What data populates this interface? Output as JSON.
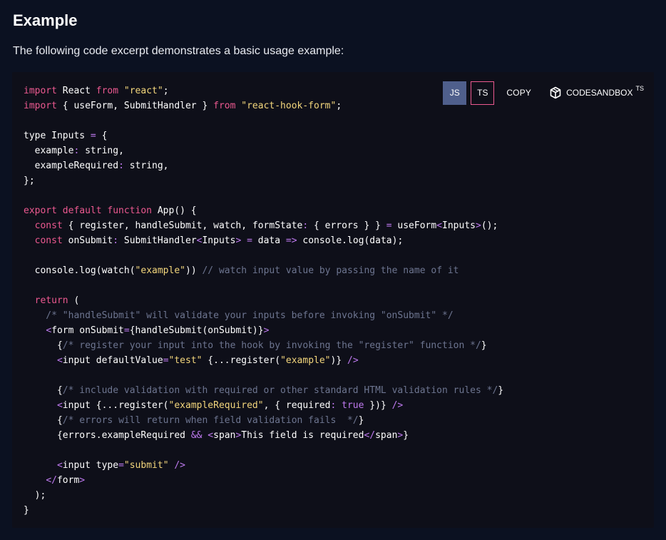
{
  "section": {
    "title": "Example",
    "description": "The following code excerpt demonstrates a basic usage example:"
  },
  "toolbar": {
    "js_label": "JS",
    "ts_label": "TS",
    "copy_label": "COPY",
    "sandbox_label": "CODESANDBOX",
    "sandbox_superscript": "TS",
    "active_language": "JS"
  },
  "colors": {
    "background": "#0b1121",
    "code_background": "#0e0f19",
    "keyword": "#ec5990",
    "string": "#f3d67c",
    "comment": "#6d7590",
    "operator": "#bf7af0",
    "active_button": "#4f5f8c"
  },
  "icons": {
    "sandbox": "codesandbox-cube-icon"
  },
  "code_lines": [
    [
      [
        "kw",
        "import"
      ],
      [
        "pl",
        " React "
      ],
      [
        "kw",
        "from"
      ],
      [
        "pl",
        " "
      ],
      [
        "str",
        "\"react\""
      ],
      [
        "pl",
        ";"
      ]
    ],
    [
      [
        "kw",
        "import"
      ],
      [
        "pl",
        " { useForm, SubmitHandler } "
      ],
      [
        "kw",
        "from"
      ],
      [
        "pl",
        " "
      ],
      [
        "str",
        "\"react-hook-form\""
      ],
      [
        "pl",
        ";"
      ]
    ],
    [],
    [
      [
        "pl",
        "type Inputs "
      ],
      [
        "op",
        "="
      ],
      [
        "pl",
        " {"
      ]
    ],
    [
      [
        "pl",
        "  example"
      ],
      [
        "op",
        ":"
      ],
      [
        "pl",
        " string,"
      ]
    ],
    [
      [
        "pl",
        "  exampleRequired"
      ],
      [
        "op",
        ":"
      ],
      [
        "pl",
        " string,"
      ]
    ],
    [
      [
        "pl",
        "};"
      ]
    ],
    [],
    [
      [
        "kw",
        "export default function"
      ],
      [
        "pl",
        " App() {"
      ]
    ],
    [
      [
        "pl",
        "  "
      ],
      [
        "kw",
        "const"
      ],
      [
        "pl",
        " { register, handleSubmit, watch, formState"
      ],
      [
        "op",
        ":"
      ],
      [
        "pl",
        " { errors } } "
      ],
      [
        "op",
        "="
      ],
      [
        "pl",
        " useForm"
      ],
      [
        "op",
        "<"
      ],
      [
        "pl",
        "Inputs"
      ],
      [
        "op",
        ">"
      ],
      [
        "pl",
        "();"
      ]
    ],
    [
      [
        "pl",
        "  "
      ],
      [
        "kw",
        "const"
      ],
      [
        "pl",
        " onSubmit"
      ],
      [
        "op",
        ":"
      ],
      [
        "pl",
        " SubmitHandler"
      ],
      [
        "op",
        "<"
      ],
      [
        "pl",
        "Inputs"
      ],
      [
        "op",
        ">"
      ],
      [
        "pl",
        " "
      ],
      [
        "op",
        "="
      ],
      [
        "pl",
        " data "
      ],
      [
        "op",
        "=>"
      ],
      [
        "pl",
        " console.log(data);"
      ]
    ],
    [],
    [
      [
        "pl",
        "  console.log(watch("
      ],
      [
        "str",
        "\"example\""
      ],
      [
        "pl",
        "))"
      ],
      [
        "cm",
        " // watch input value by passing the name of it"
      ]
    ],
    [],
    [
      [
        "pl",
        "  "
      ],
      [
        "kw",
        "return"
      ],
      [
        "pl",
        " ("
      ]
    ],
    [
      [
        "cm",
        "    /* \"handleSubmit\" will validate your inputs before invoking \"onSubmit\" */"
      ]
    ],
    [
      [
        "pl",
        "    "
      ],
      [
        "op",
        "<"
      ],
      [
        "pl",
        "form onSubmit"
      ],
      [
        "op",
        "="
      ],
      [
        "pl",
        "{handleSubmit(onSubmit)}"
      ],
      [
        "op",
        ">"
      ]
    ],
    [
      [
        "pl",
        "      {"
      ],
      [
        "cm",
        "/* register your input into the hook by invoking the \"register\" function */"
      ],
      [
        "pl",
        "}"
      ]
    ],
    [
      [
        "pl",
        "      "
      ],
      [
        "op",
        "<"
      ],
      [
        "pl",
        "input defaultValue"
      ],
      [
        "op",
        "="
      ],
      [
        "str",
        "\"test\""
      ],
      [
        "pl",
        " {...register("
      ],
      [
        "str",
        "\"example\""
      ],
      [
        "pl",
        ")} "
      ],
      [
        "op",
        "/>"
      ]
    ],
    [],
    [
      [
        "pl",
        "      {"
      ],
      [
        "cm",
        "/* include validation with required or other standard HTML validation rules */"
      ],
      [
        "pl",
        "}"
      ]
    ],
    [
      [
        "pl",
        "      "
      ],
      [
        "op",
        "<"
      ],
      [
        "pl",
        "input {...register("
      ],
      [
        "str",
        "\"exampleRequired\""
      ],
      [
        "pl",
        ", { required"
      ],
      [
        "op",
        ":"
      ],
      [
        "pl",
        " "
      ],
      [
        "op",
        "true"
      ],
      [
        "pl",
        " })} "
      ],
      [
        "op",
        "/>"
      ]
    ],
    [
      [
        "pl",
        "      {"
      ],
      [
        "cm",
        "/* errors will return when field validation fails  */"
      ],
      [
        "pl",
        "}"
      ]
    ],
    [
      [
        "pl",
        "      {errors.exampleRequired "
      ],
      [
        "op",
        "&&"
      ],
      [
        "pl",
        " "
      ],
      [
        "op",
        "<"
      ],
      [
        "pl",
        "span"
      ],
      [
        "op",
        ">"
      ],
      [
        "pl",
        "This field is required"
      ],
      [
        "op",
        "</"
      ],
      [
        "pl",
        "span"
      ],
      [
        "op",
        ">"
      ],
      [
        "pl",
        "}"
      ]
    ],
    [],
    [
      [
        "pl",
        "      "
      ],
      [
        "op",
        "<"
      ],
      [
        "pl",
        "input type"
      ],
      [
        "op",
        "="
      ],
      [
        "str",
        "\"submit\""
      ],
      [
        "pl",
        " "
      ],
      [
        "op",
        "/>"
      ]
    ],
    [
      [
        "pl",
        "    "
      ],
      [
        "op",
        "</"
      ],
      [
        "pl",
        "form"
      ],
      [
        "op",
        ">"
      ]
    ],
    [
      [
        "pl",
        "  );"
      ]
    ],
    [
      [
        "pl",
        "}"
      ]
    ]
  ]
}
